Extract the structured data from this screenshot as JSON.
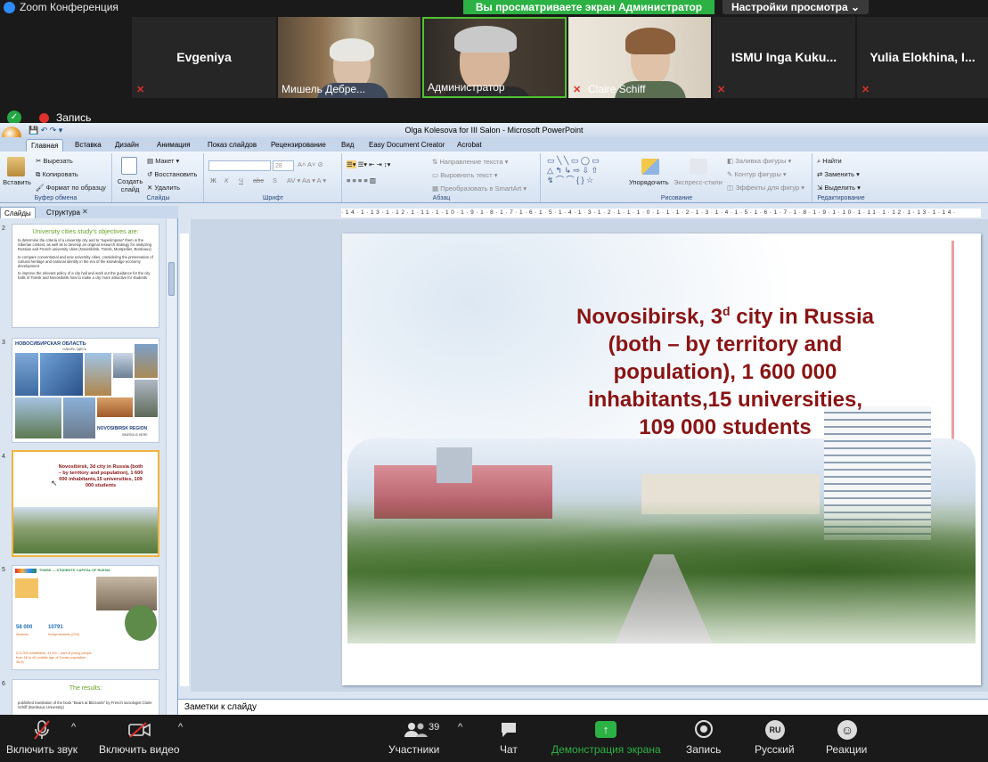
{
  "zoom": {
    "window_title": "Zoom Конференция",
    "share_banner": "Вы просматриваете экран Администратор",
    "view_options": "Настройки просмотра",
    "recording_label": "Запись",
    "participants": [
      {
        "name": "Evgeniya",
        "video": false,
        "muted": true
      },
      {
        "name": "Мишель Дебре...",
        "video": true,
        "muted": true
      },
      {
        "name": "Администратор",
        "video": true,
        "muted": false,
        "active": true
      },
      {
        "name": "Claire Schiff",
        "video": true,
        "muted": true
      },
      {
        "name": "ISMU Inga Kuku...",
        "video": false,
        "muted": true
      },
      {
        "name": "Yulia Elokhina, I...",
        "video": false,
        "muted": true
      }
    ],
    "toolbar": {
      "audio": "Включить звук",
      "video": "Включить видео",
      "participants": "Участники",
      "participants_count": "39",
      "chat": "Чат",
      "share": "Демонстрация экрана",
      "record": "Запись",
      "language_badge": "RU",
      "language": "Русский",
      "reactions": "Реакции"
    },
    "colors": {
      "green": "#2cb144",
      "red": "#e0302a",
      "blue": "#2d8cff"
    }
  },
  "ppt": {
    "title": "Olga Kolesova for III Salon - Microsoft PowerPoint",
    "tabs": [
      "Главная",
      "Вставка",
      "Дизайн",
      "Анимация",
      "Показ слайдов",
      "Рецензирование",
      "Вид",
      "Easy Document Creator",
      "Acrobat"
    ],
    "ribbon": {
      "clipboard": {
        "paste": "Вставить",
        "cut": "Вырезать",
        "copy": "Копировать",
        "format": "Формат по образцу",
        "label": "Буфер обмена"
      },
      "slides": {
        "create": "Создать слайд",
        "layout": "Макет",
        "reset": "Восстановить",
        "delete": "Удалить",
        "label": "Слайды"
      },
      "font": {
        "size": "28",
        "bold": "Ж",
        "italic": "К",
        "underline": "Ч",
        "strike": "abc",
        "shadow": "S",
        "label": "Шрифт"
      },
      "paragraph": {
        "direction": "Направление текста",
        "align": "Выровнять текст",
        "smartart": "Преобразовать в SmartArt",
        "label": "Абзац"
      },
      "drawing": {
        "arrange": "Упорядочить",
        "styles": "Экспресс-стили",
        "fill": "Заливка фигуры",
        "outline": "Контур фигуры",
        "effects": "Эффекты для фигур",
        "label": "Рисование"
      },
      "editing": {
        "find": "Найти",
        "replace": "Заменить",
        "select": "Выделить",
        "label": "Редактирование"
      }
    },
    "pane_tabs": [
      "Слайды",
      "Структура"
    ],
    "thumbnails": [
      {
        "num": "2",
        "title": "University cities study’s objectives are:",
        "bullets": [
          "to determine the criteria of a university city and to “superimpose” them in the Siberian context, as well as to develop an original research strategy for analyzing Russian and French university cities (Novosibirsk, Tomsk, Montpellier, Bordeaux)",
          "to compare conventional and new university cities, considering the preservation of cultural heritage and national identity in the era of the knowledge economy development",
          "to improve the relevant policy of a city hall and work out the guidance for the city halls of Tomsk and Novosibirsk how to make a city more attractive for students"
        ]
      },
      {
        "num": "3",
        "header": "НОВОСИБИРСКАЯ ОБЛАСТЬ",
        "sub": "СИБИРЬ ЗДЕСЬ",
        "footer": "NOVOSIBIRSK REGION",
        "footer_sub": "SIBERIA IS HERE"
      },
      {
        "num": "4",
        "text": "Novosibirsk, 3d city in Russia (both – by territory and population), 1 600 000 inhabitants,15 universities, 109 000 students"
      },
      {
        "num": "5",
        "header": "TOMSK — STUDENTS' CAPITAL OF RUSSIA",
        "stat1": "58 000",
        "stat1_label": "Students",
        "stat2": "10791",
        "stat2_label": "foreign students (22%)",
        "note": "574 000 inhabitants, 41.4% – part of young people from 16 to 40 (middle age of Tomsk population – 36.6)"
      },
      {
        "num": "6",
        "title": "The results:",
        "bullets": [
          "published translation of the book “Bears at Blizzards” by French sociologist Claire Schiff (Bordeaux University)"
        ]
      }
    ],
    "slide": {
      "heading_line1": "Novosibirsk, 3",
      "heading_sup": "d",
      "heading_line1_end": " city in Russia",
      "heading_line2": "(both – by territory and",
      "heading_line3": "population), 1 600 000",
      "heading_line4": "inhabitants,15 universities,",
      "heading_line5": "109 000 students",
      "heading_color": "#8a1414"
    },
    "ruler_text": "·14·1·13·1·12·1·11·1·10·1·9·1·8·1·7·1·6·1·5·1·4·1·3·1·2·1·1·1·0·1·1·1·2·1·3·1·4·1·5·1·6·1·7·1·8·1·9·1·10·1·11·1·12·1·13·1·14·",
    "notes_placeholder": "Заметки к слайду"
  }
}
